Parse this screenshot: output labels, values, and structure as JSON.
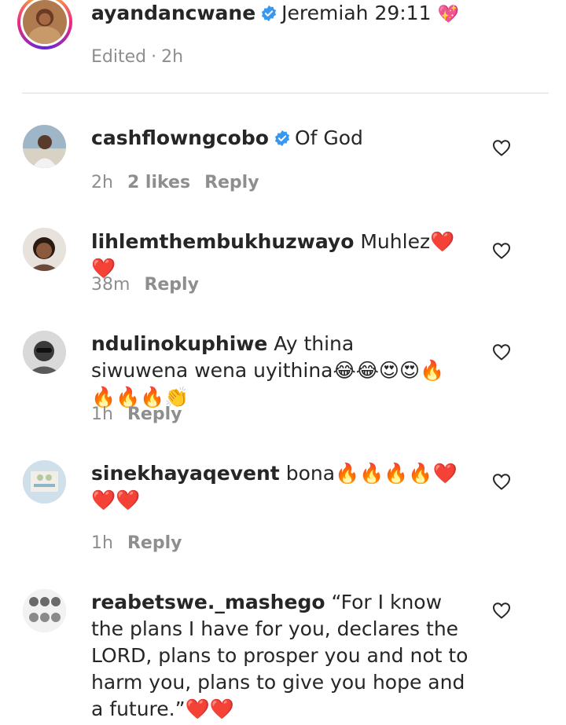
{
  "caption": {
    "username": "ayandancwane",
    "text": "Jeremiah 29:11",
    "emoji": "💖",
    "edited_label": "Edited",
    "time": "2h"
  },
  "comments": [
    {
      "username": "cashflowngcobo",
      "verified": true,
      "text": "Of God",
      "time": "2h",
      "likes": "2 likes",
      "reply_label": "Reply"
    },
    {
      "username": "lihlemthembukhuzwayo",
      "verified": false,
      "text": "Muhlez❤️❤️",
      "time": "38m",
      "reply_label": "Reply"
    },
    {
      "username": "ndulinokuphiwe",
      "verified": false,
      "text": "Ay thina siwuwena wena uyithina😂😂😍😍🔥🔥🔥🔥👏",
      "time": "1h",
      "reply_label": "Reply"
    },
    {
      "username": "sinekhayaqevent",
      "verified": false,
      "text": "bona🔥🔥🔥🔥❤️❤️❤️",
      "time": "1h",
      "reply_label": "Reply"
    },
    {
      "username": "reabetswe._mashego",
      "verified": false,
      "text": "“For I know the plans I have for you, declares the LORD, plans to prosper you and not to harm you, plans to give you hope and a future.”❤️❤️",
      "time": "",
      "reply_label": ""
    }
  ],
  "icons": {
    "like": "heart-outline-icon",
    "verified": "verified-badge-icon"
  },
  "colors": {
    "verified_blue": "#3897f0",
    "meta_gray": "#8e8e8e",
    "text_dark": "#262626"
  }
}
